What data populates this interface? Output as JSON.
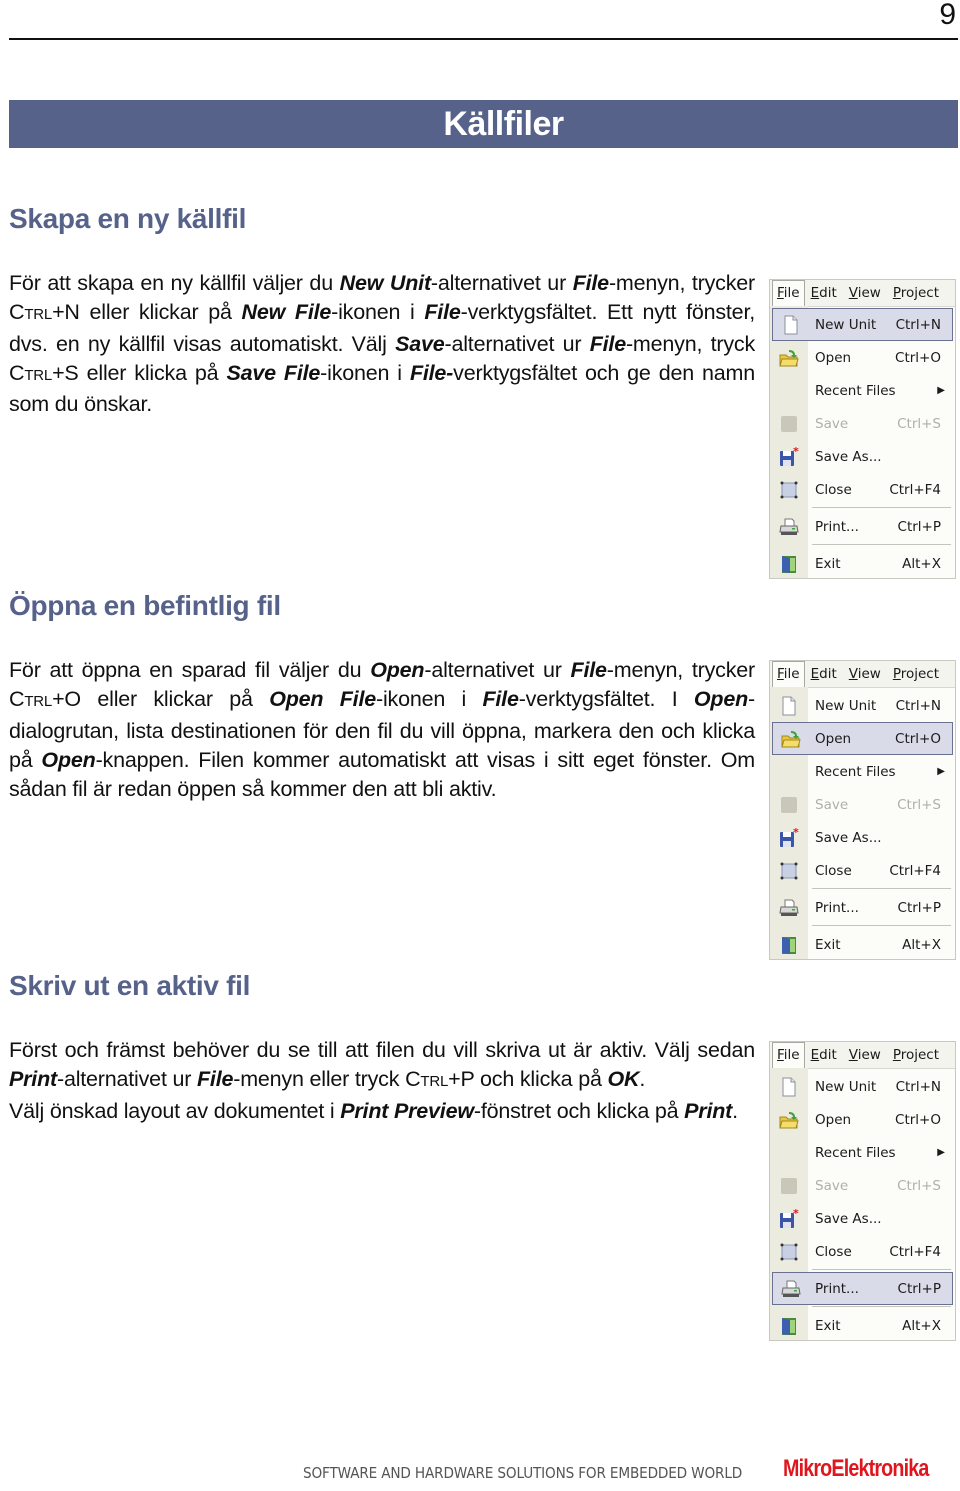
{
  "page": {
    "number": "9",
    "title": "Källfiler"
  },
  "sections": [
    {
      "heading": "Skapa en ny källfil",
      "paragraph": [
        {
          "t": "För att skapa en ny källfil väljer du "
        },
        {
          "b": "New Unit"
        },
        {
          "t": "-alternativet ur "
        },
        {
          "b": "File"
        },
        {
          "t": "-menyn, trycker "
        },
        {
          "sc": "Ctrl+N"
        },
        {
          "t": " eller klickar på "
        },
        {
          "b": "New File"
        },
        {
          "t": "-ikonen i "
        },
        {
          "b": "File"
        },
        {
          "t": "-verktygsfältet. Ett nytt fönster, dvs. en ny källfil visas automatiskt. Välj "
        },
        {
          "b": "Save"
        },
        {
          "t": "-alternativet ur "
        },
        {
          "b": "File"
        },
        {
          "t": "-menyn, tryck "
        },
        {
          "sc": "Ctrl+S"
        },
        {
          "t": " eller klicka på "
        },
        {
          "b": "Save File"
        },
        {
          "t": "-ikonen i "
        },
        {
          "b": "File-"
        },
        {
          "t": "verktygsfältet och ge den namn som du önskar."
        }
      ],
      "menu_highlight": "New Unit"
    },
    {
      "heading": "Öppna en befintlig fil",
      "paragraph": [
        {
          "t": "För att öppna en sparad fil väljer du "
        },
        {
          "b": "Open"
        },
        {
          "t": "-alternativet ur "
        },
        {
          "b": "File"
        },
        {
          "t": "-menyn, trycker "
        },
        {
          "sc": "Ctrl+O"
        },
        {
          "t": " eller klickar på "
        },
        {
          "b": "Open File"
        },
        {
          "t": "-ikonen i "
        },
        {
          "b": "File"
        },
        {
          "t": "-verktygsfältet. I "
        },
        {
          "b": "Open"
        },
        {
          "t": "-dialogrutan, lista destinationen för den fil du vill öppna, markera den och klicka på "
        },
        {
          "b": "Open"
        },
        {
          "t": "-knappen. Filen kommer automatiskt att visas i sitt eget fönster. Om sådan fil är redan öppen så kommer den att bli aktiv."
        }
      ],
      "menu_highlight": "Open"
    },
    {
      "heading": "Skriv ut en aktiv fil",
      "paragraph": [
        {
          "t": "Först och främst behöver du se till att filen du vill skriva ut är aktiv. Välj sedan "
        },
        {
          "b": "Print"
        },
        {
          "t": "-alternativet ur "
        },
        {
          "b": "File"
        },
        {
          "t": "-menyn eller tryck "
        },
        {
          "sc": "Ctrl+P"
        },
        {
          "t": " och klicka på "
        },
        {
          "b": "OK"
        },
        {
          "t": "."
        },
        {
          "br": true
        },
        {
          "t": "Välj önskad layout av dokumentet i "
        },
        {
          "b": "Print Preview"
        },
        {
          "t": "-fönstret och klicka på "
        },
        {
          "b": "Print"
        },
        {
          "t": "."
        }
      ],
      "menu_highlight": "Print..."
    }
  ],
  "menu": {
    "menubar": [
      {
        "label": "File",
        "accel": "F"
      },
      {
        "label": "Edit",
        "accel": "E"
      },
      {
        "label": "View",
        "accel": "V"
      },
      {
        "label": "Project",
        "accel": "P"
      }
    ],
    "items": [
      {
        "label": "New Unit",
        "shortcut": "Ctrl+N",
        "icon": "new-file-icon"
      },
      {
        "label": "Open",
        "shortcut": "Ctrl+O",
        "icon": "open-folder-icon"
      },
      {
        "label": "Recent Files",
        "shortcut": "",
        "icon": "",
        "submenu": true
      },
      {
        "label": "Save",
        "shortcut": "Ctrl+S",
        "icon": "save-icon",
        "disabled": true
      },
      {
        "label": "Save As...",
        "shortcut": "",
        "icon": "save-as-icon"
      },
      {
        "label": "Close",
        "shortcut": "Ctrl+F4",
        "icon": "close-file-icon",
        "separator_after": true
      },
      {
        "label": "Print...",
        "shortcut": "Ctrl+P",
        "icon": "printer-icon",
        "separator_after": true
      },
      {
        "label": "Exit",
        "shortcut": "Alt+X",
        "icon": "exit-icon"
      }
    ]
  },
  "footer": {
    "tagline": "SOFTWARE AND HARDWARE SOLUTIONS FOR EMBEDDED WORLD",
    "brand": "MikroElektronika"
  },
  "colors": {
    "accent": "#56628a",
    "brand": "#e0161e"
  }
}
